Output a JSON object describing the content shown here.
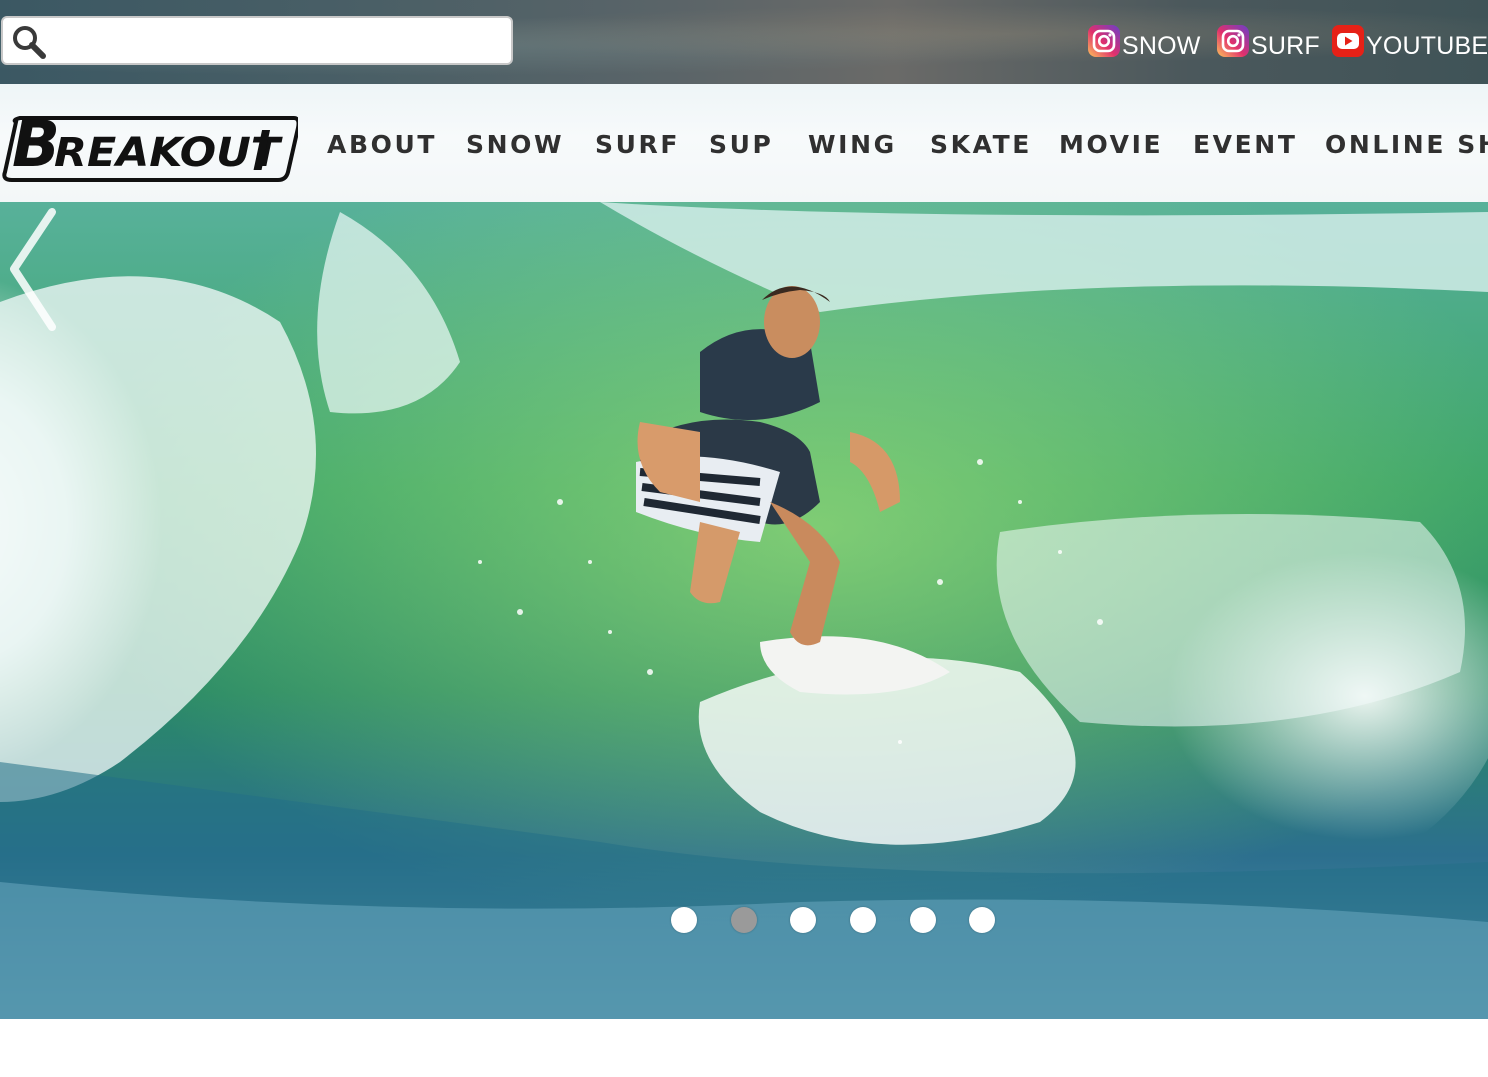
{
  "search": {
    "placeholder": "",
    "value": ""
  },
  "social": [
    {
      "label": "SNOW",
      "icon": "instagram-icon"
    },
    {
      "label": "SURF",
      "icon": "instagram-icon"
    },
    {
      "label": "YOUTUBE",
      "icon": "youtube-icon"
    }
  ],
  "logo": {
    "text": "BREAKOUT"
  },
  "nav": {
    "items": [
      {
        "label": "ABOUT"
      },
      {
        "label": "SNOW"
      },
      {
        "label": "SURF"
      },
      {
        "label": "SUP"
      },
      {
        "label": "WING"
      },
      {
        "label": "SKATE"
      },
      {
        "label": "MOVIE"
      },
      {
        "label": "EVENT"
      },
      {
        "label": "ONLINE SHO"
      }
    ]
  },
  "slider": {
    "slide_count": 6,
    "active_index": 1,
    "prev_icon": "chevron-left-icon"
  },
  "colors": {
    "nav_text": "#303030",
    "youtube_red": "#e62117",
    "dot_active": "#9a9a9a"
  }
}
